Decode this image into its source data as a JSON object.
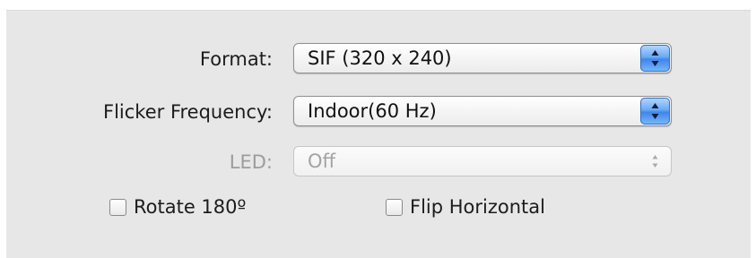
{
  "form": {
    "format": {
      "label": "Format:",
      "value": "SIF (320 x 240)"
    },
    "flicker": {
      "label": "Flicker Frequency:",
      "value": "Indoor(60 Hz)"
    },
    "led": {
      "label": "LED:",
      "value": "Off",
      "disabled": true
    },
    "rotate": {
      "label": "Rotate 180º",
      "checked": false
    },
    "flip": {
      "label": "Flip Horizontal",
      "checked": false
    }
  },
  "colors": {
    "panel": "#e7e7e7",
    "stepper_accent": "#4a8ff0",
    "disabled_text": "#9c9c9c"
  }
}
